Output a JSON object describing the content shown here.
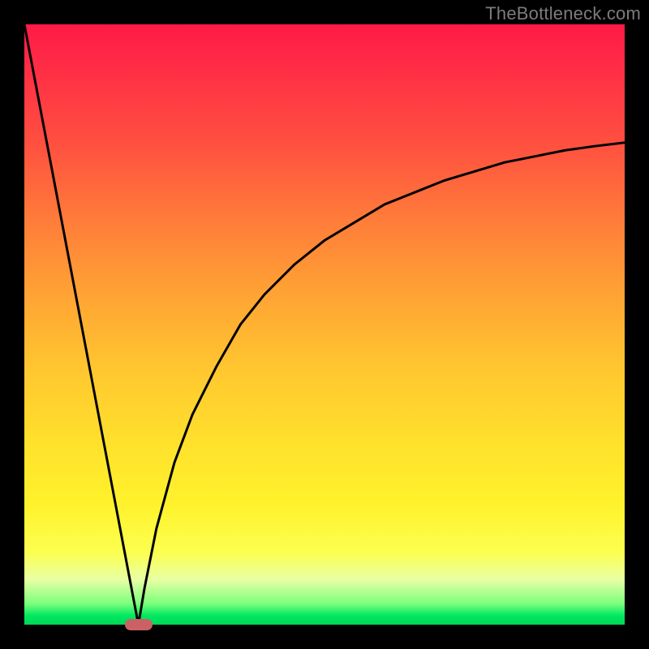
{
  "watermark": {
    "text": "TheBottleneck.com"
  },
  "colors": {
    "page_bg": "#000000",
    "gradient_stops": [
      "#ff1a46",
      "#ff5040",
      "#ffa334",
      "#ffe12c",
      "#fcff50",
      "#7cff7c",
      "#00d758"
    ],
    "curve": "#000000",
    "marker": "#cb6165"
  },
  "chart_data": {
    "type": "line",
    "title": "",
    "xlabel": "",
    "ylabel": "",
    "xlim": [
      0,
      100
    ],
    "ylim": [
      0,
      100
    ],
    "grid": false,
    "legend": false,
    "annotations": [
      {
        "kind": "marker",
        "x": 19,
        "y": 0
      }
    ],
    "series": [
      {
        "name": "left-line",
        "x": [
          0,
          19
        ],
        "y": [
          100,
          0
        ]
      },
      {
        "name": "right-curve",
        "x": [
          19,
          20,
          22,
          25,
          28,
          32,
          36,
          40,
          45,
          50,
          55,
          60,
          65,
          70,
          75,
          80,
          85,
          90,
          95,
          100
        ],
        "y": [
          0,
          6,
          16,
          27,
          35,
          43,
          50,
          55,
          60,
          64,
          67,
          70,
          72,
          74,
          75.5,
          77,
          78,
          79,
          79.7,
          80.3
        ]
      }
    ]
  }
}
